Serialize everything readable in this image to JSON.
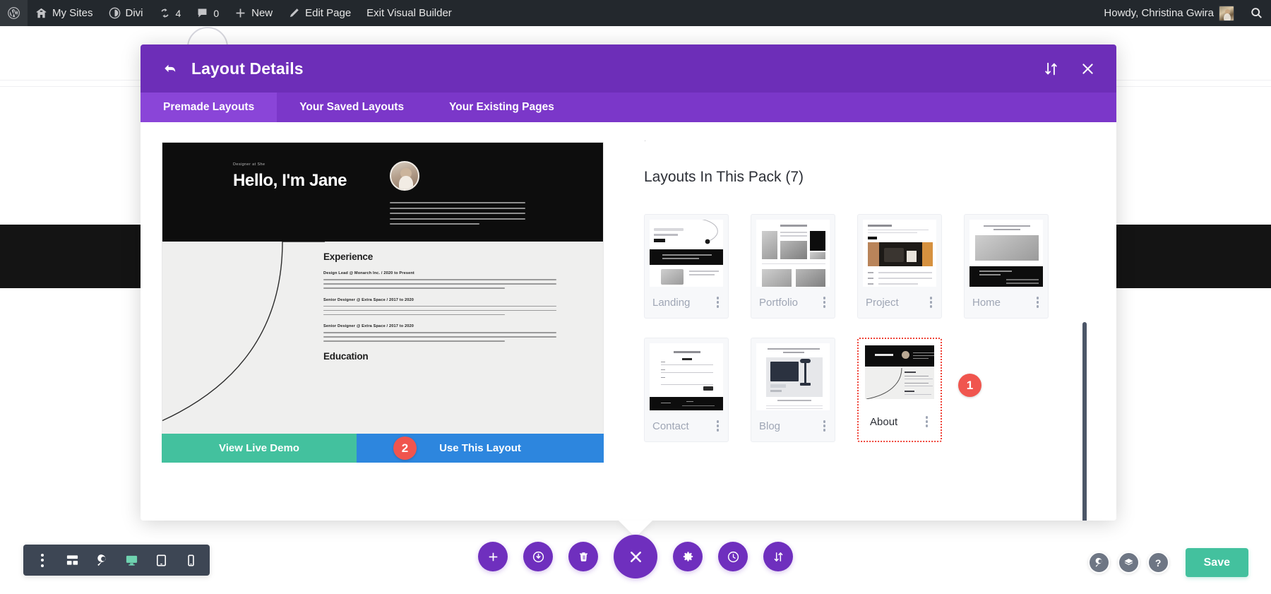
{
  "adminbar": {
    "logo_icon": "wordpress-logo-icon",
    "items": [
      {
        "label": "My Sites",
        "icon": "sites-icon"
      },
      {
        "label": "Divi",
        "icon": "divi-icon"
      },
      {
        "label": "4",
        "icon": "updates-icon"
      },
      {
        "label": "0",
        "icon": "comments-icon"
      },
      {
        "label": "New",
        "icon": "plus-icon"
      },
      {
        "label": "Edit Page",
        "icon": "pencil-icon"
      },
      {
        "label": "Exit Visual Builder",
        "icon": ""
      }
    ],
    "howdy": "Howdy, Christina Gwira",
    "avatar_icon": "avatar",
    "search_icon": "search-icon"
  },
  "modal": {
    "title": "Layout Details",
    "back_icon": "back-arrow-icon",
    "sort_icon": "sort-updown-icon",
    "close_icon": "close-x-icon",
    "tabs": [
      {
        "label": "Premade Layouts",
        "active": true
      },
      {
        "label": "Your Saved Layouts",
        "active": false
      },
      {
        "label": "Your Existing Pages",
        "active": false
      }
    ],
    "preview": {
      "hero_eyebrow": "Designer at She",
      "hero_title": "Hello, I'm Jane",
      "section_experience": "Experience",
      "section_education": "Education",
      "jobs": [
        "Design Lead  @  Monarch Inc.  /  2020 to Present",
        "Senior Designer  @  Extra Space  /  2017 to 2020",
        "Senior Designer  @  Extra Space  /  2017 to 2020"
      ]
    },
    "actions": {
      "demo_label": "View Live Demo",
      "use_label": "Use This Layout",
      "use_badge": "2"
    },
    "list": {
      "heading": "Layouts In This Pack (7)",
      "selected_badge": "1",
      "kebab_icon": "kebab-menu-icon",
      "cards": [
        {
          "name": "Landing",
          "selected": false
        },
        {
          "name": "Portfolio",
          "selected": false
        },
        {
          "name": "Project",
          "selected": false
        },
        {
          "name": "Home",
          "selected": false
        },
        {
          "name": "Contact",
          "selected": false
        },
        {
          "name": "Blog",
          "selected": false
        },
        {
          "name": "About",
          "selected": true
        }
      ]
    }
  },
  "left_toolbar": {
    "buttons": [
      {
        "name": "more-options-icon",
        "active": false
      },
      {
        "name": "wireframe-view-icon",
        "active": false
      },
      {
        "name": "zoom-out-view-icon",
        "active": false
      },
      {
        "name": "desktop-view-icon",
        "active": true
      },
      {
        "name": "tablet-view-icon",
        "active": false
      },
      {
        "name": "phone-view-icon",
        "active": false
      }
    ]
  },
  "center_toolbar": {
    "buttons": [
      {
        "name": "add-section-icon",
        "big": false
      },
      {
        "name": "toggle-power-icon",
        "big": false
      },
      {
        "name": "trash-icon",
        "big": false
      },
      {
        "name": "close-builder-icon",
        "big": true
      },
      {
        "name": "settings-gear-icon",
        "big": false
      },
      {
        "name": "history-clock-icon",
        "big": false
      },
      {
        "name": "portability-icon",
        "big": false
      }
    ]
  },
  "right_toolbar": {
    "buttons": [
      {
        "name": "search-icon",
        "glyph": ""
      },
      {
        "name": "layers-icon",
        "glyph": ""
      },
      {
        "name": "help-icon",
        "glyph": "?"
      }
    ],
    "save_label": "Save"
  },
  "colors": {
    "adminbar_bg": "#23282d",
    "modal_header": "#6d2eb8",
    "modal_tabs": "#7b37c9",
    "tab_active": "#8a45d8",
    "demo_button": "#43c19e",
    "use_button": "#2d86de",
    "badge_red": "#f0554e",
    "selected_border": "#ef4136",
    "builder_purple": "#6f2fbe",
    "scrollbar": "#4c5668",
    "toolbar_dark": "#3d4654"
  }
}
